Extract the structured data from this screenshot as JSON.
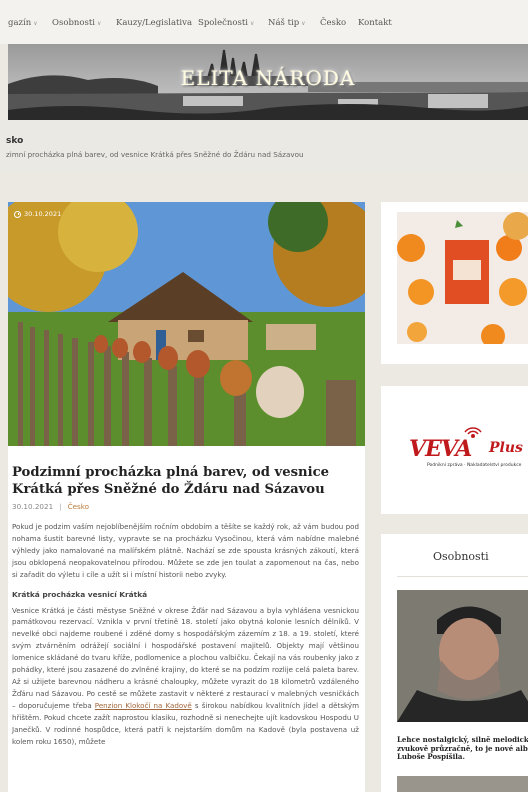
{
  "nav": {
    "items": [
      {
        "label": "gazín",
        "has_dropdown": true
      },
      {
        "label": "Osobnosti",
        "has_dropdown": true
      },
      {
        "label": "Kauzy/Legislativa",
        "has_dropdown": false
      },
      {
        "label": "Společnosti",
        "has_dropdown": true
      },
      {
        "label": "Náš tip",
        "has_dropdown": true
      },
      {
        "label": "Česko",
        "has_dropdown": false
      },
      {
        "label": "Kontakt",
        "has_dropdown": false
      }
    ]
  },
  "header": {
    "site_title": "ELITA NÁRODA"
  },
  "breadcrumb": {
    "heading": "sko",
    "path": "zimní procházka plná barev, od vesnice Krátká přes Sněžné do Ždáru nad Sázavou"
  },
  "article": {
    "image_date": "30.10.2021",
    "title": "Podzimní procházka plná barev, od vesnice Krátká přes Sněžné do Ždáru nad Sázavou",
    "date": "30.10.2021",
    "category": "Česko",
    "intro": "Pokud je podzim vaším nejoblíbenějším ročním obdobím a těšíte se každý rok, až vám budou pod nohama šustit barevné listy, vypravte se na procházku Vysočinou, která vám nabídne malebné výhledy jako namalované na malířském plátně. Nachází se zde spousta krásných zákoutí, která jsou obklopená neopakovatelnou přírodou. Můžete se zde jen toulat a zapomenout na čas, nebo si zařadit do výletu i cíle a užít si i místní historii nebo zvyky.",
    "subheading": "Krátká procházka vesnicí Krátká",
    "body_before_link": "Vesnice Krátká je části městyse Sněžné v okrese Žďár nad Sázavou a byla vyhlášena vesnickou památkovou rezervací. Vznikla v první třetině 18. století jako obytná kolonie lesních dělníků. V nevelké obci najdeme roubené i zděné domy s hospodářským zázemím z 18. a 19. století, které svým ztvárněním odrážejí sociální i hospodářské postavení majitelů. Objekty mají většinou lomenice skládané do tvaru kříže, podlomenice a plochou valbičku. Čekají na vás roubenky jako z pohádky, které jsou zasazené do zvlněné krajiny, do které se na podzim rozlije celá paleta barev. Až si užijete barevnou nádheru a krásné chaloupky, můžete vyrazit do 18 kilometrů vzdáleného Žďáru nad Sázavou. Po cestě se můžete zastavit v některé z restaurací v malebných vesničkách – doporučujeme třeba ",
    "link_text": "Penzion Klokočí na Kadově",
    "body_after_link": " s širokou nabídkou kvalitních jídel a dětským hřištěm. Pokud chcete zažít naprostou klasiku, rozhodně si nenechejte ujít kadovskou Hospodu U Janečků. V rodinné hospůdce, která patří k nejstarším domům na Kadově (byla postavena už kolem roku 1650), můžete"
  },
  "sidebar": {
    "veva": {
      "logo": "VEVA",
      "plus": "Plus",
      "tagline": "Podnikní zpráva · Nakladatelství produkce"
    },
    "osobnosti": {
      "title": "Osobnosti",
      "caption": "Lehce nostalgický, silně melodický a zvukově průzračně, to je nové album Luboše Pospíšila."
    }
  },
  "colors": {
    "accent_link": "#b97b3c",
    "veva_red": "#c0191c",
    "background": "#ece9e3"
  }
}
